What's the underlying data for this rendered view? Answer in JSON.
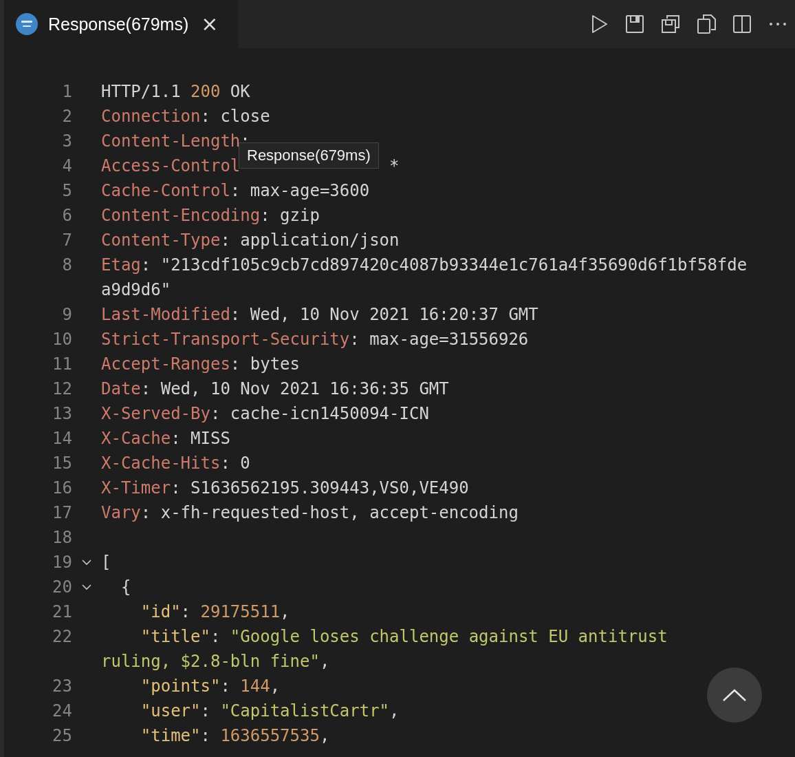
{
  "tab": {
    "title": "Response(679ms)",
    "close": "×"
  },
  "tooltip": "Response(679ms)",
  "lines": [
    {
      "number": "1",
      "tokens": [
        {
          "kind": "text",
          "text": "HTTP/1.1 "
        },
        {
          "kind": "number",
          "text": "200"
        },
        {
          "kind": "text",
          "text": " OK"
        }
      ]
    },
    {
      "number": "2",
      "tokens": [
        {
          "kind": "header",
          "text": "Connection"
        },
        {
          "kind": "text",
          "text": ": close"
        }
      ]
    },
    {
      "number": "3",
      "tokens": [
        {
          "kind": "header",
          "text": "Content-Length"
        },
        {
          "kind": "text",
          "text": ":"
        }
      ]
    },
    {
      "number": "4",
      "tokens": [
        {
          "kind": "header",
          "text": "Access-Control"
        },
        {
          "kind": "covered"
        },
        {
          "kind": "text",
          "text": " *"
        }
      ]
    },
    {
      "number": "5",
      "tokens": [
        {
          "kind": "header",
          "text": "Cache-Control"
        },
        {
          "kind": "text",
          "text": ": max-age=3600"
        }
      ]
    },
    {
      "number": "6",
      "tokens": [
        {
          "kind": "header",
          "text": "Content-Encoding"
        },
        {
          "kind": "text",
          "text": ": gzip"
        }
      ]
    },
    {
      "number": "7",
      "tokens": [
        {
          "kind": "header",
          "text": "Content-Type"
        },
        {
          "kind": "text",
          "text": ": application/json"
        }
      ]
    },
    {
      "number": "8",
      "tokens": [
        {
          "kind": "header",
          "text": "Etag"
        },
        {
          "kind": "text",
          "text": ": \"213cdf105c9cb7cd897420c4087b93344e1c761a4f35690d6f1bf58fdea9d9d6\""
        }
      ]
    },
    {
      "number": "9",
      "tokens": [
        {
          "kind": "header",
          "text": "Last-Modified"
        },
        {
          "kind": "text",
          "text": ": Wed, 10 Nov 2021 16:20:37 GMT"
        }
      ]
    },
    {
      "number": "10",
      "tokens": [
        {
          "kind": "header",
          "text": "Strict-Transport-Security"
        },
        {
          "kind": "text",
          "text": ": max-age=31556926"
        }
      ]
    },
    {
      "number": "11",
      "tokens": [
        {
          "kind": "header",
          "text": "Accept-Ranges"
        },
        {
          "kind": "text",
          "text": ": bytes"
        }
      ]
    },
    {
      "number": "12",
      "tokens": [
        {
          "kind": "header",
          "text": "Date"
        },
        {
          "kind": "text",
          "text": ": Wed, 10 Nov 2021 16:36:35 GMT"
        }
      ]
    },
    {
      "number": "13",
      "tokens": [
        {
          "kind": "header",
          "text": "X-Served-By"
        },
        {
          "kind": "text",
          "text": ": cache-icn1450094-ICN"
        }
      ]
    },
    {
      "number": "14",
      "tokens": [
        {
          "kind": "header",
          "text": "X-Cache"
        },
        {
          "kind": "text",
          "text": ": MISS"
        }
      ]
    },
    {
      "number": "15",
      "tokens": [
        {
          "kind": "header",
          "text": "X-Cache-Hits"
        },
        {
          "kind": "text",
          "text": ": 0"
        }
      ]
    },
    {
      "number": "16",
      "tokens": [
        {
          "kind": "header",
          "text": "X-Timer"
        },
        {
          "kind": "text",
          "text": ": S1636562195.309443,VS0,VE490"
        }
      ]
    },
    {
      "number": "17",
      "tokens": [
        {
          "kind": "header",
          "text": "Vary"
        },
        {
          "kind": "text",
          "text": ": x-fh-requested-host, accept-encoding"
        }
      ]
    },
    {
      "number": "18"
    },
    {
      "number": "19",
      "expanded": true,
      "tokens": [
        {
          "kind": "text",
          "text": "["
        }
      ]
    },
    {
      "number": "20",
      "expanded": true,
      "tokens": [
        {
          "kind": "text",
          "text": "  {"
        }
      ]
    },
    {
      "number": "21",
      "tokens": [
        {
          "kind": "key",
          "text": "    \"id\""
        },
        {
          "kind": "text",
          "text": ": "
        },
        {
          "kind": "number",
          "text": "29175511"
        },
        {
          "kind": "text",
          "text": ","
        }
      ]
    },
    {
      "number": "22",
      "tokens": [
        {
          "kind": "key",
          "text": "    \"title\""
        },
        {
          "kind": "text",
          "text": ": "
        },
        {
          "kind": "string",
          "text": "\"Google loses challenge against EU antitrust ruling, $2.8-bln fine\""
        },
        {
          "kind": "text",
          "text": ","
        }
      ]
    },
    {
      "number": "23",
      "tokens": [
        {
          "kind": "key",
          "text": "    \"points\""
        },
        {
          "kind": "text",
          "text": ": "
        },
        {
          "kind": "number",
          "text": "144"
        },
        {
          "kind": "text",
          "text": ","
        }
      ]
    },
    {
      "number": "24",
      "tokens": [
        {
          "kind": "key",
          "text": "    \"user\""
        },
        {
          "kind": "text",
          "text": ": "
        },
        {
          "kind": "string",
          "text": "\"CapitalistCartr\""
        },
        {
          "kind": "text",
          "text": ","
        }
      ]
    },
    {
      "number": "25",
      "tokens": [
        {
          "kind": "key",
          "text": "    \"time\""
        },
        {
          "kind": "text",
          "text": ": "
        },
        {
          "kind": "number",
          "text": "1636557535"
        },
        {
          "kind": "text",
          "text": ","
        }
      ]
    }
  ]
}
